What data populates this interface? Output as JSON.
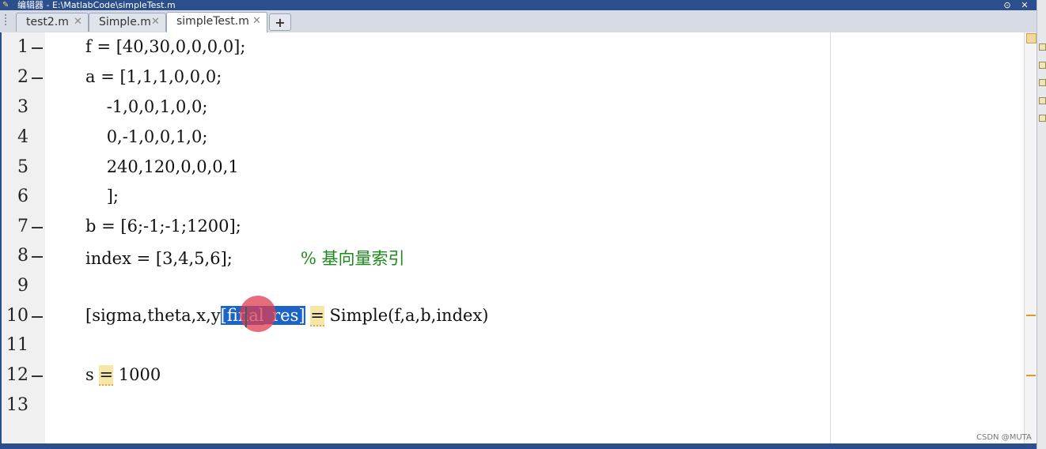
{
  "window": {
    "title": "编辑器 - E:\\MatlabCode\\simpleTest.m"
  },
  "tabs": [
    {
      "label": "test2.m",
      "close": "✕"
    },
    {
      "label": "Simple.m",
      "close": "✕"
    },
    {
      "label": "simpleTest.m",
      "close": "✕"
    }
  ],
  "add_tab_label": "+",
  "editor": {
    "line_numbers": [
      "1",
      "2",
      "3",
      "4",
      "5",
      "6",
      "7",
      "8",
      "9",
      "10",
      "11",
      "12",
      "13"
    ],
    "lines": {
      "l1": "f = [40,30,0,0,0,0];",
      "l2": "a = [1,1,1,0,0,0;",
      "l3": "    -1,0,0,1,0,0;",
      "l4": "    0,-1,0,0,1,0;",
      "l5": "    240,120,0,0,0,1",
      "l6": "    ];",
      "l7": "b = [6;-1;-1;1200];",
      "l8_code": "index = [3,4,5,6];",
      "l8_comment": "% 基向量索引",
      "l10_a": "[sigma,theta,x,y",
      "l10_sel": "[final_res]",
      "l10_eq": "=",
      "l10_b": " Simple(f,a,b,index)",
      "l12_a": "s ",
      "l12_eq": "=",
      "l12_b": " 1000"
    }
  },
  "watermark": "CSDN @MUTA",
  "colors": {
    "title_bar": "#2b4f8c",
    "comment": "#1b8a1b",
    "selection": "#1c64c8",
    "highlight": "#f6e6a8"
  }
}
